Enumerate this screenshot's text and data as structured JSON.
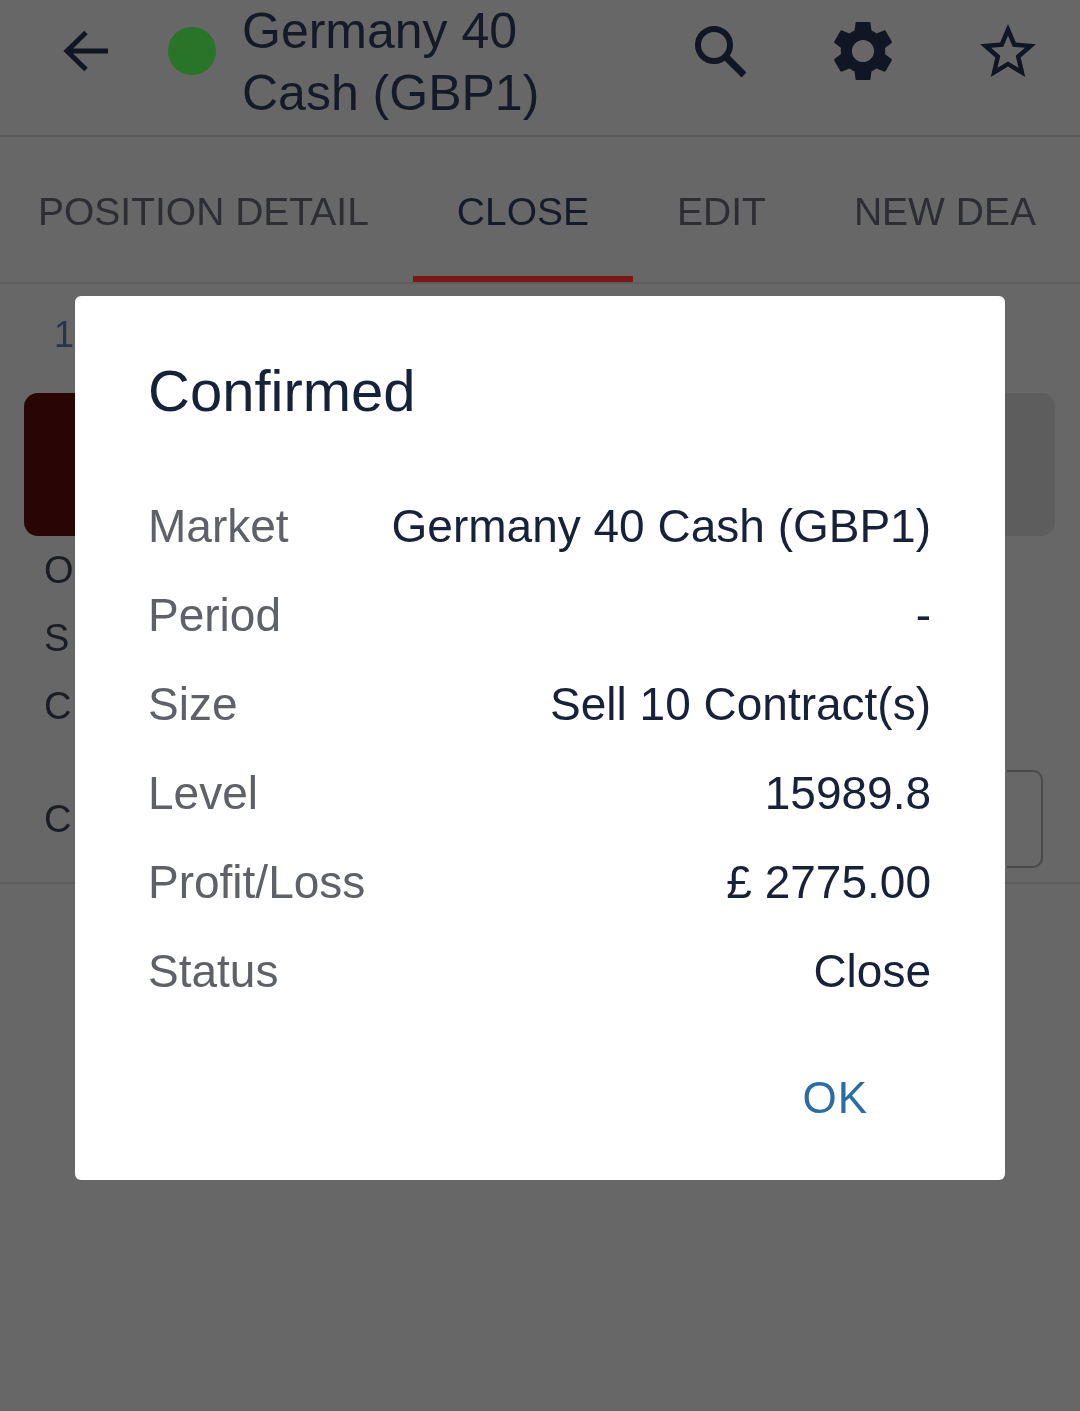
{
  "header": {
    "title": "Germany 40 Cash (GBP1)",
    "starred": false
  },
  "tabs": [
    {
      "label": "POSITION DETAIL",
      "selected": false
    },
    {
      "label": "CLOSE",
      "selected": true
    },
    {
      "label": "EDIT",
      "selected": false
    },
    {
      "label": "NEW DEA",
      "selected": false
    }
  ],
  "content": {
    "text_1": "1",
    "options": [
      {
        "selected": true
      },
      {
        "selected": false
      }
    ],
    "rows": [
      {
        "label": "O",
        "kind": "text"
      },
      {
        "label": "S",
        "kind": "text"
      },
      {
        "label": "C",
        "kind": "text"
      },
      {
        "label": "C",
        "kind": "field"
      }
    ]
  },
  "dialog": {
    "title": "Confirmed",
    "rows": [
      {
        "label": "Market",
        "value": "Germany 40 Cash (GBP1)"
      },
      {
        "label": "Period",
        "value": "-"
      },
      {
        "label": "Size",
        "value": "Sell 10 Contract(s)"
      },
      {
        "label": "Level",
        "value": "15989.8"
      },
      {
        "label": "Profit/Loss",
        "value": "£ 2775.00"
      },
      {
        "label": "Status",
        "value": "Close"
      }
    ],
    "button": "OK"
  }
}
